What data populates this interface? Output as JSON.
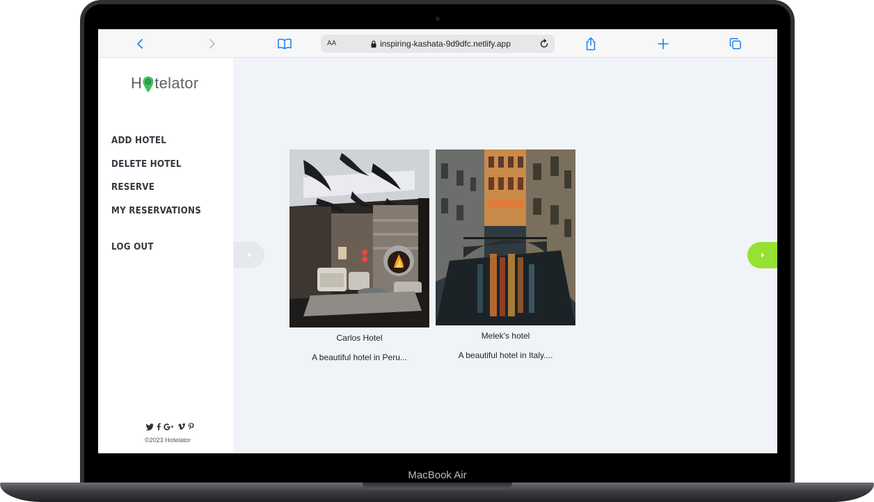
{
  "device": {
    "label": "MacBook Air"
  },
  "browser": {
    "text_size_label": "AA",
    "url": "inspiring-kashata-9d9dfc.netlify.app"
  },
  "sidebar": {
    "logo_text_before": "H",
    "logo_text_after": "telator",
    "nav": [
      {
        "label": "ADD HOTEL"
      },
      {
        "label": "DELETE HOTEL"
      },
      {
        "label": "RESERVE"
      },
      {
        "label": "MY RESERVATIONS"
      },
      {
        "label": "LOG OUT"
      }
    ],
    "social_icons": [
      "twitter-icon",
      "facebook-icon",
      "google-plus-icon",
      "vimeo-icon",
      "pinterest-icon"
    ],
    "copyright": "©2023 Hotelator"
  },
  "hotels": [
    {
      "name": "Carlos Hotel",
      "description": "A beautiful hotel in Peru...",
      "image": "hotel-lobby-photo"
    },
    {
      "name": "Melek's hotel",
      "description": "A beautiful hotel in Italy....",
      "image": "venice-canal-photo"
    }
  ],
  "colors": {
    "accent": "#97e034",
    "logo_pin": "#3cc05b",
    "safari_blue": "#1a7ff0",
    "background": "#f0f3f8"
  }
}
